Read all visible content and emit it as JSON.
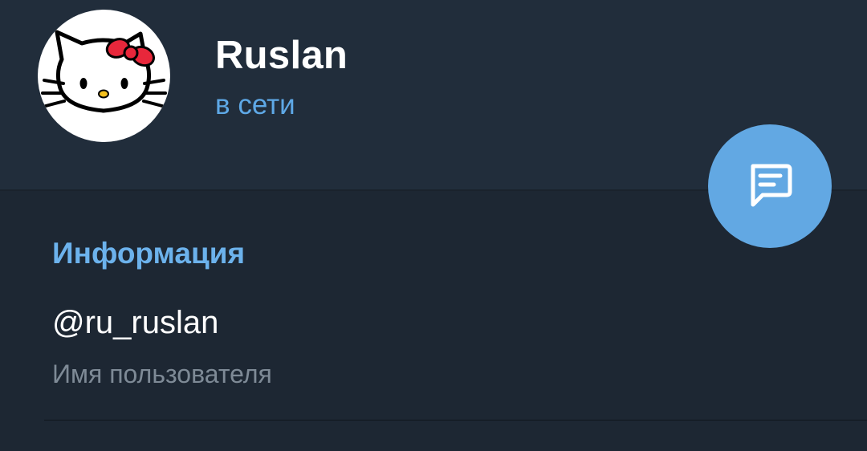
{
  "profile": {
    "name": "Ruslan",
    "status": "в сети",
    "avatar_icon": "hello-kitty-avatar"
  },
  "info": {
    "section_title": "Информация",
    "username": "@ru_ruslan",
    "username_label": "Имя пользователя"
  },
  "actions": {
    "message_icon": "message-icon"
  },
  "colors": {
    "header_bg": "#212d3b",
    "page_bg": "#1d2733",
    "accent": "#62a8e3",
    "status_text": "#5ea8e6",
    "section_title": "#6cb2ec",
    "secondary_text": "#7e8a96"
  }
}
